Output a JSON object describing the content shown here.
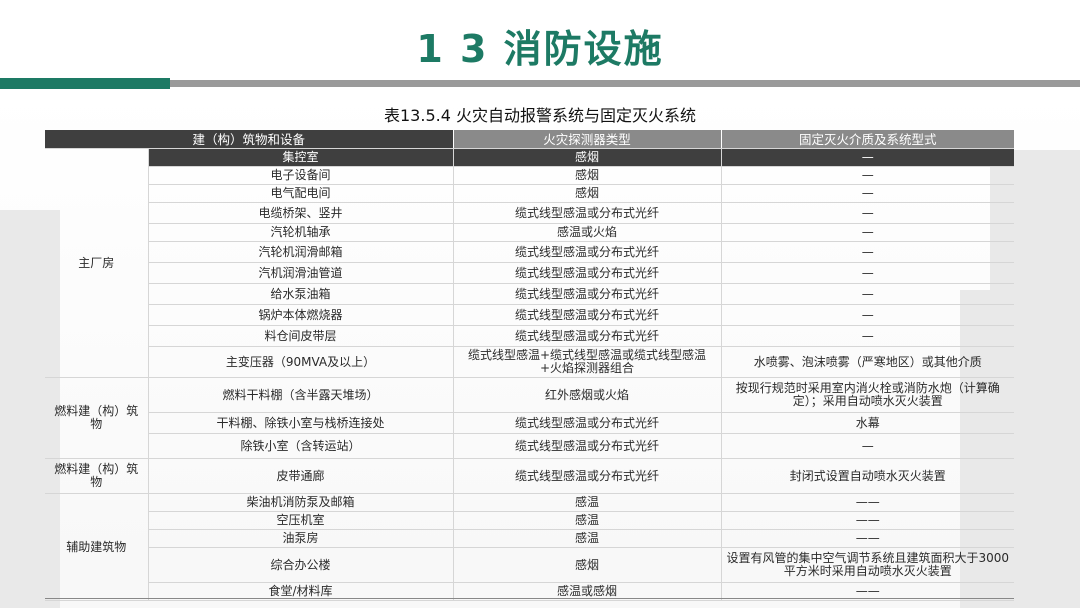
{
  "slide": {
    "title": "1 3 消防设施",
    "caption": "表13.5.4 火灾自动报警系统与固定灭火系统"
  },
  "table": {
    "headers": [
      "建（构）筑物和设备",
      "火灾探测器类型",
      "固定灭火介质及系统型式"
    ],
    "groups": [
      {
        "label": "主厂房",
        "rows": [
          [
            "集控室",
            "感烟",
            "—"
          ],
          [
            "电子设备间",
            "感烟",
            "—"
          ],
          [
            "电气配电间",
            "感烟",
            "—"
          ],
          [
            "电缆桥架、竖井",
            "缆式线型感温或分布式光纤",
            "—"
          ],
          [
            "汽轮机轴承",
            "感温或火焰",
            "—"
          ],
          [
            "汽轮机润滑邮箱",
            "缆式线型感温或分布式光纤",
            "—"
          ],
          [
            "汽机润滑油管道",
            "缆式线型感温或分布式光纤",
            "—"
          ],
          [
            "给水泵油箱",
            "缆式线型感温或分布式光纤",
            "—"
          ],
          [
            "锅炉本体燃烧器",
            "缆式线型感温或分布式光纤",
            "—"
          ],
          [
            "料仓间皮带层",
            "缆式线型感温或分布式光纤",
            "—"
          ],
          [
            "主变压器（90MVA及以上）",
            "缆式线型感温+缆式线型感温或缆式线型感温+火焰探测器组合",
            "水喷雾、泡沫喷雾（严寒地区）或其他介质"
          ]
        ]
      },
      {
        "label": "燃料建（构）筑物",
        "rows": [
          [
            "燃料干料棚（含半露天堆场）",
            "红外感烟或火焰",
            "按现行规范时采用室内消火栓或消防水炮（计算确定）；采用自动喷水灭火装置"
          ],
          [
            "干料棚、除铁小室与栈桥连接处",
            "缆式线型感温或分布式光纤",
            "水幕"
          ],
          [
            "除铁小室（含转运站）",
            "缆式线型感温或分布式光纤",
            "—"
          ]
        ]
      },
      {
        "label": "燃料建（构）筑物",
        "rows": [
          [
            "皮带通廊",
            "缆式线型感温或分布式光纤",
            "封闭式设置自动喷水灭火装置"
          ]
        ]
      },
      {
        "label": "辅助建筑物",
        "rows": [
          [
            "柴油机消防泵及邮箱",
            "感温",
            "——"
          ],
          [
            "空压机室",
            "感温",
            "——"
          ],
          [
            "油泵房",
            "感温",
            "——"
          ],
          [
            "综合办公楼",
            "感烟",
            "设置有风管的集中空气调节系统且建筑面积大于3000平方米时采用自动喷水灭火装置"
          ],
          [
            "食堂/材料库",
            "感温或感烟",
            "——"
          ]
        ]
      }
    ]
  }
}
